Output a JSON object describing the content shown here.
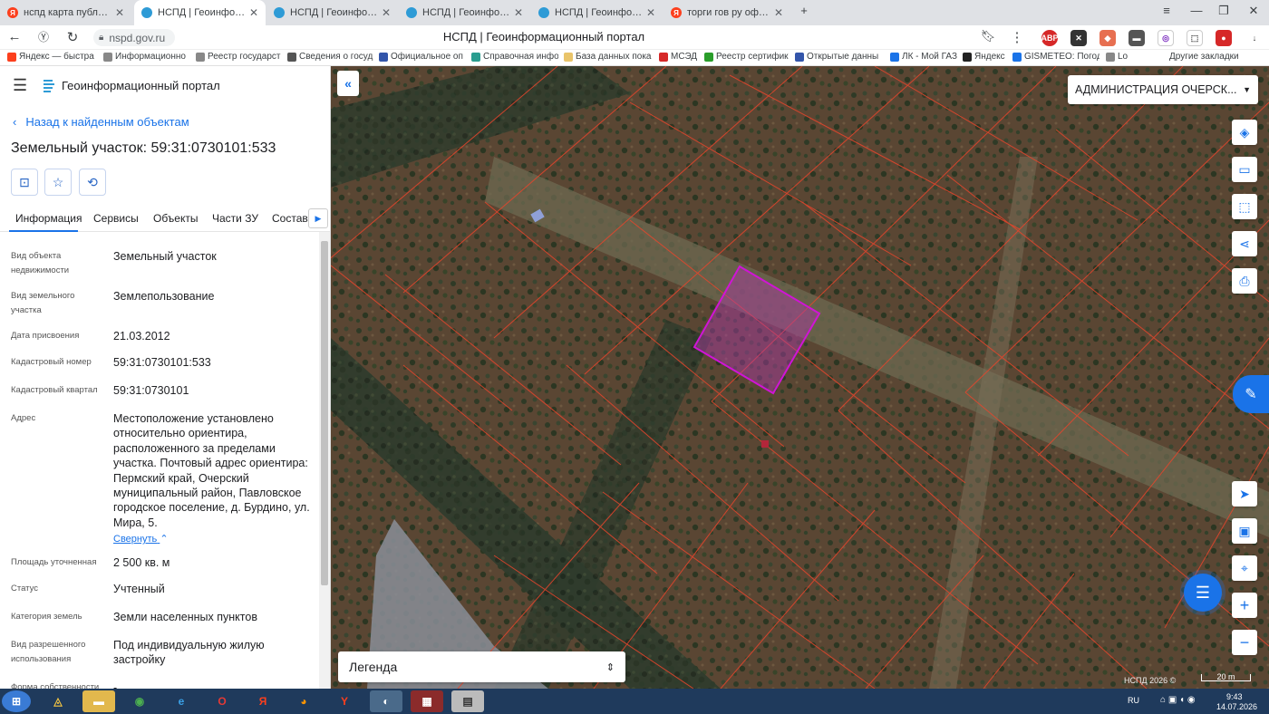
{
  "browser": {
    "tabs": [
      {
        "title": "нспд карта публичная кад",
        "fav_color": "#fc3f1d",
        "fav_glyph": "Я",
        "active": false
      },
      {
        "title": "НСПД | Геоинформацио",
        "fav_color": "#2e9bd6",
        "fav_glyph": "",
        "active": true
      },
      {
        "title": "НСПД | Геоинформацион",
        "fav_color": "#2e9bd6",
        "fav_glyph": "",
        "active": false
      },
      {
        "title": "НСПД | Геоинформацион",
        "fav_color": "#2e9bd6",
        "fav_glyph": "",
        "active": false
      },
      {
        "title": "НСПД | Геоинформацион",
        "fav_color": "#2e9bd6",
        "fav_glyph": "",
        "active": false
      },
      {
        "title": "торги гов ру официальны",
        "fav_color": "#fc3f1d",
        "fav_glyph": "Я",
        "active": false
      }
    ],
    "url": "nspd.gov.ru",
    "page_title": "НСПД | Геоинформационный портал",
    "bookmarks": [
      {
        "label": "Яндекс — быстра",
        "color": "#fc3f1d"
      },
      {
        "label": "Информационно",
        "color": "#888888"
      },
      {
        "label": "Реестр государст",
        "color": "#888888"
      },
      {
        "label": "Сведения о госуд",
        "color": "#555555"
      },
      {
        "label": "Официальное оп",
        "color": "#3355aa"
      },
      {
        "label": "Справочная инфо",
        "color": "#2a9d8f"
      },
      {
        "label": "База данных пока",
        "color": "#e9c46a"
      },
      {
        "label": "МСЭД",
        "color": "#d62828"
      },
      {
        "label": "Реестр сертифик",
        "color": "#2a9d2a"
      },
      {
        "label": "Открытые данны",
        "color": "#3355aa"
      },
      {
        "label": "ЛК - Мой ГАЗ",
        "color": "#1a73e8"
      },
      {
        "label": "Яндекс",
        "color": "#222222"
      },
      {
        "label": "GISMETEO: Погод",
        "color": "#1a73e8"
      },
      {
        "label": "Lo",
        "color": "#888888"
      }
    ],
    "other_bookmarks": "Другие закладки"
  },
  "app": {
    "title": "Геоинформационный портал",
    "back_link": "Назад к найденным объектам",
    "parcel_title": "Земельный участок: 59:31:0730101:533",
    "tabs": [
      "Информация",
      "Сервисы",
      "Объекты",
      "Части ЗУ",
      "Состав"
    ],
    "properties": [
      {
        "label": "Вид объекта недвижимости",
        "value": "Земельный участок"
      },
      {
        "label": "Вид земельного участка",
        "value": "Землепользование"
      },
      {
        "label": "Дата присвоения",
        "value": "21.03.2012"
      },
      {
        "label": "Кадастровый номер",
        "value": "59:31:0730101:533"
      },
      {
        "label": "Кадастровый квартал",
        "value": "59:31:0730101"
      },
      {
        "label": "Адрес",
        "value": "Местоположение установлено относительно ориентира, расположенного за пределами участка. Почтовый адрес ориентира: Пермский край, Очерский муниципальный район, Павловское городское поселение, д. Бурдино, ул. Мира, 5."
      },
      {
        "label": "Площадь уточненная",
        "value": "2 500 кв. м"
      },
      {
        "label": "Статус",
        "value": "Учтенный"
      },
      {
        "label": "Категория земель",
        "value": "Земли населенных пунктов"
      },
      {
        "label": "Вид разрешенного использования",
        "value": "Под индивидуальную жилую застройку"
      },
      {
        "label": "Форма собственности",
        "value": "-"
      }
    ],
    "collapse_label": "Свернуть"
  },
  "map": {
    "region": "АДМИНИСТРАЦИЯ ОЧЕРСК...",
    "legend": "Легенда",
    "copyright": "НСПД 2026 ©",
    "scale": "20 m",
    "parcel_color": "#d014d6",
    "boundary_color": "#e8452c"
  },
  "taskbar": {
    "lang": "RU",
    "time": "9:43",
    "date": "14.07.2026"
  }
}
